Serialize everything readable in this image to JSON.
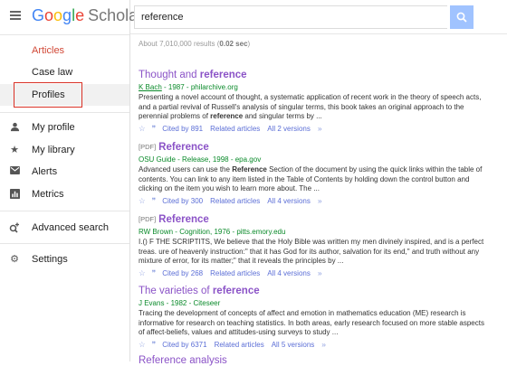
{
  "app": {
    "logo_google": "Google",
    "logo_scholar": "Scholar"
  },
  "sidebar": {
    "items": [
      {
        "label": "Articles",
        "icon": ""
      },
      {
        "label": "Case law",
        "icon": ""
      },
      {
        "label": "Profiles",
        "icon": ""
      },
      {
        "label": "My profile",
        "icon": "person-icon"
      },
      {
        "label": "My library",
        "icon": "star-icon"
      },
      {
        "label": "Alerts",
        "icon": "mail-icon"
      },
      {
        "label": "Metrics",
        "icon": "metrics-icon"
      },
      {
        "label": "Advanced search",
        "icon": "advanced-search-icon"
      },
      {
        "label": "Settings",
        "icon": "gear-icon"
      }
    ]
  },
  "search": {
    "value": "reference",
    "placeholder": ""
  },
  "results_count": {
    "prefix": "About 7,010,000 results (",
    "time": "0.02 sec",
    "suffix": ")"
  },
  "results": [
    {
      "pdf": "",
      "title_pre": "Thought and ",
      "title_bold": "reference",
      "title_post": "",
      "author": "K Bach",
      "meta": " - 1987 - philarchive.org",
      "snippet_1": "Presenting a novel account of thought, a systematic application of recent work in the theory of speech acts, and a partial revival of Russell's analysis of singular terms, this book takes an original approach to the perennial problems of ",
      "snippet_bold": "reference",
      "snippet_2": " and singular terms by ...",
      "cited": "Cited by 891",
      "related": "Related articles",
      "versions": "All 2 versions"
    },
    {
      "pdf": "[PDF]",
      "title_pre": "",
      "title_bold": "Reference",
      "title_post": "",
      "author": "",
      "meta": "OSU Guide - Release, 1998 - epa.gov",
      "snippet_1": "Advanced users can use the ",
      "snippet_bold": "Reference",
      "snippet_2": " Section of the document by using the quick links within the table of contents. You can link to any item listed in the Table of Contents by holding down the control button and clicking on the item you wish to learn more about. The ...",
      "cited": "Cited by 300",
      "related": "Related articles",
      "versions": "All 4 versions"
    },
    {
      "pdf": "[PDF]",
      "title_pre": "",
      "title_bold": "Reference",
      "title_post": "",
      "author": "",
      "meta": "RW Brown - Cognition, 1976 - pitts.emory.edu",
      "snippet_1": "I.() F THE SCRIPTITS, We believe that the Holy Bible was written my men divinely inspired, and is a perfect treas. ure of heavenly instruction:\" that it has God for its author, salvation for its end,\" and truth without any mixture of error, for its matter;\" that it reveals the principles by ...",
      "snippet_bold": "",
      "snippet_2": "",
      "cited": "Cited by 268",
      "related": "Related articles",
      "versions": "All 4 versions"
    },
    {
      "pdf": "",
      "title_pre": "The varieties of ",
      "title_bold": "reference",
      "title_post": "",
      "author": "",
      "meta": "J Evans - 1982 - Citeseer",
      "snippet_1": "Tracing the development of concepts of affect and emotion in mathematics education (ME) research is informative for research on teaching statistics. In both areas, early research focused on more stable aspects of affect-beliefs, values and attitudes-using surveys to study ...",
      "snippet_bold": "",
      "snippet_2": "",
      "cited": "Cited by 6371",
      "related": "Related articles",
      "versions": "All 5 versions"
    }
  ],
  "truncated_result": "Reference analysis"
}
